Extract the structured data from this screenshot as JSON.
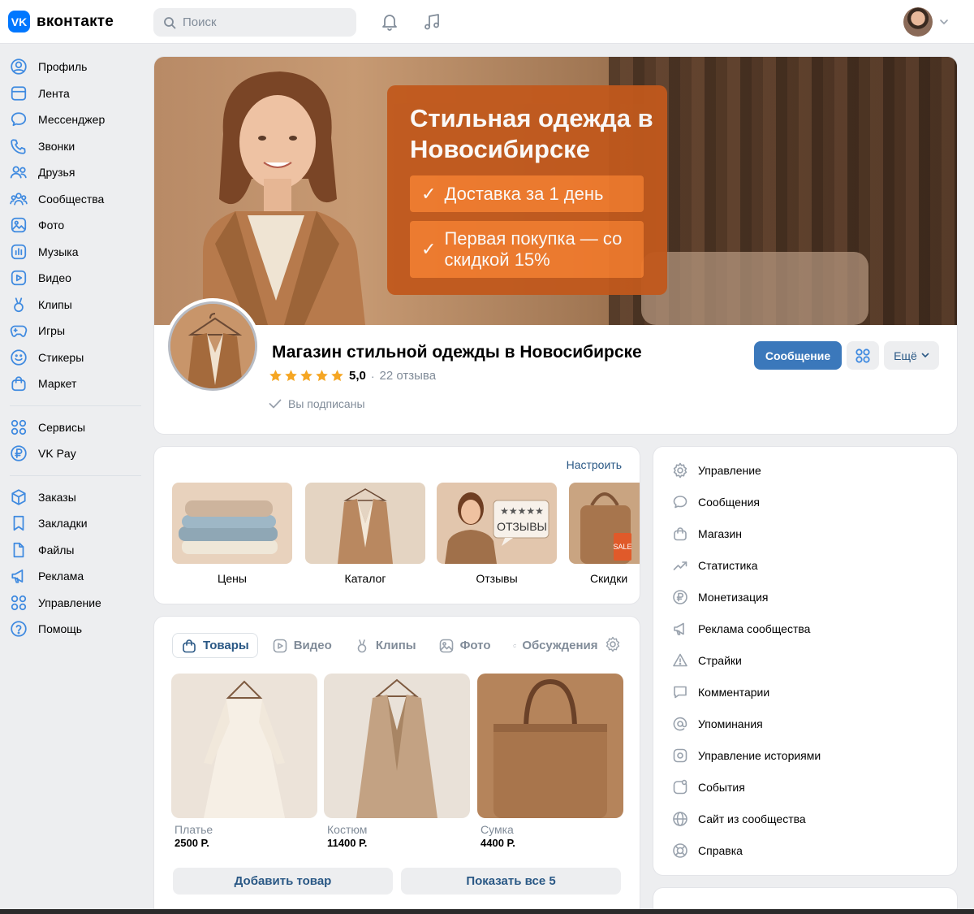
{
  "header": {
    "logo_badge": "VK",
    "logo_text": "вконтакте",
    "search_placeholder": "Поиск"
  },
  "sidebar": {
    "group1": [
      {
        "id": "profile",
        "label": "Профиль",
        "icon": "user-circle-icon"
      },
      {
        "id": "feed",
        "label": "Лента",
        "icon": "newsfeed-icon"
      },
      {
        "id": "messenger",
        "label": "Мессенджер",
        "icon": "chat-bubble-icon"
      },
      {
        "id": "calls",
        "label": "Звонки",
        "icon": "phone-icon"
      },
      {
        "id": "friends",
        "label": "Друзья",
        "icon": "friends-icon"
      },
      {
        "id": "communities",
        "label": "Сообщества",
        "icon": "communities-icon"
      },
      {
        "id": "photos",
        "label": "Фото",
        "icon": "photo-icon"
      },
      {
        "id": "music",
        "label": "Музыка",
        "icon": "music-icon"
      },
      {
        "id": "video",
        "label": "Видео",
        "icon": "video-icon"
      },
      {
        "id": "clips",
        "label": "Клипы",
        "icon": "clips-icon"
      },
      {
        "id": "games",
        "label": "Игры",
        "icon": "gamepad-icon"
      },
      {
        "id": "stickers",
        "label": "Стикеры",
        "icon": "smile-icon"
      },
      {
        "id": "market",
        "label": "Маркет",
        "icon": "shopping-bag-icon"
      }
    ],
    "group2": [
      {
        "id": "services",
        "label": "Сервисы",
        "icon": "grid-icon"
      },
      {
        "id": "vkpay",
        "label": "VK Pay",
        "icon": "ruble-circle-icon"
      }
    ],
    "group3": [
      {
        "id": "orders",
        "label": "Заказы",
        "icon": "box-icon"
      },
      {
        "id": "bookmarks",
        "label": "Закладки",
        "icon": "bookmark-icon"
      },
      {
        "id": "files",
        "label": "Файлы",
        "icon": "file-icon"
      },
      {
        "id": "ads",
        "label": "Реклама",
        "icon": "megaphone-icon"
      },
      {
        "id": "management",
        "label": "Управление",
        "icon": "grid-icon"
      },
      {
        "id": "help",
        "label": "Помощь",
        "icon": "question-circle-icon"
      }
    ]
  },
  "cover": {
    "promo_title": "Стильная одежда в Новосибирске",
    "promo_check": "✓",
    "promo_line1": "Доставка за 1 день",
    "promo_line2": "Первая покупка — со скидкой 15%"
  },
  "group": {
    "name": "Магазин стильной одежды в Новосибирске",
    "rating": "5,0",
    "rating_separator": "·",
    "rating_stars": 5,
    "reviews": "22 отзыва",
    "subscribed": "Вы подписаны",
    "message_button": "Сообщение",
    "more_button": "Ещё"
  },
  "widgets": {
    "configure": "Настроить",
    "items": [
      {
        "label": "Цены"
      },
      {
        "label": "Каталог"
      },
      {
        "label": "Отзывы",
        "badge_stars": "★★★★★",
        "badge_text": "ОТЗЫВЫ"
      },
      {
        "label": "Скидки",
        "tag": "SALE"
      }
    ]
  },
  "goods": {
    "tabs": [
      {
        "label": "Товары",
        "icon": "shopping-bag-icon",
        "active": true
      },
      {
        "label": "Видео",
        "icon": "video-icon"
      },
      {
        "label": "Клипы",
        "icon": "clips-icon"
      },
      {
        "label": "Фото",
        "icon": "photo-icon"
      },
      {
        "label": "Обсуждения",
        "icon": "chat-bubble-icon"
      }
    ],
    "products": [
      {
        "name": "Платье",
        "price": "2500 Р."
      },
      {
        "name": "Костюм",
        "price": "11400 Р."
      },
      {
        "name": "Сумка",
        "price": "4400 Р."
      }
    ],
    "add_button": "Добавить товар",
    "show_all_button": "Показать все 5"
  },
  "admin_menu": [
    {
      "label": "Управление",
      "icon": "gear-icon"
    },
    {
      "label": "Сообщения",
      "icon": "chat-bubble-icon"
    },
    {
      "label": "Магазин",
      "icon": "shopping-bag-icon"
    },
    {
      "label": "Статистика",
      "icon": "trend-icon"
    },
    {
      "label": "Монетизация",
      "icon": "ruble-circle-icon"
    },
    {
      "label": "Реклама сообщества",
      "icon": "megaphone-icon"
    },
    {
      "label": "Страйки",
      "icon": "warning-icon"
    },
    {
      "label": "Комментарии",
      "icon": "comment-icon"
    },
    {
      "label": "Упоминания",
      "icon": "at-icon"
    },
    {
      "label": "Управление историями",
      "icon": "stories-icon"
    },
    {
      "label": "События",
      "icon": "calendar-icon"
    },
    {
      "label": "Сайт из сообщества",
      "icon": "globe-icon"
    },
    {
      "label": "Справка",
      "icon": "lifebuoy-icon"
    }
  ],
  "colors": {
    "accent": "#2a5885",
    "primary_button": "#3b78bb",
    "logo": "#0077ff",
    "promo_box": "#c1591d",
    "promo_pill": "#ef7a2d",
    "star": "#f5a623",
    "icon": "#3f8ae0"
  }
}
